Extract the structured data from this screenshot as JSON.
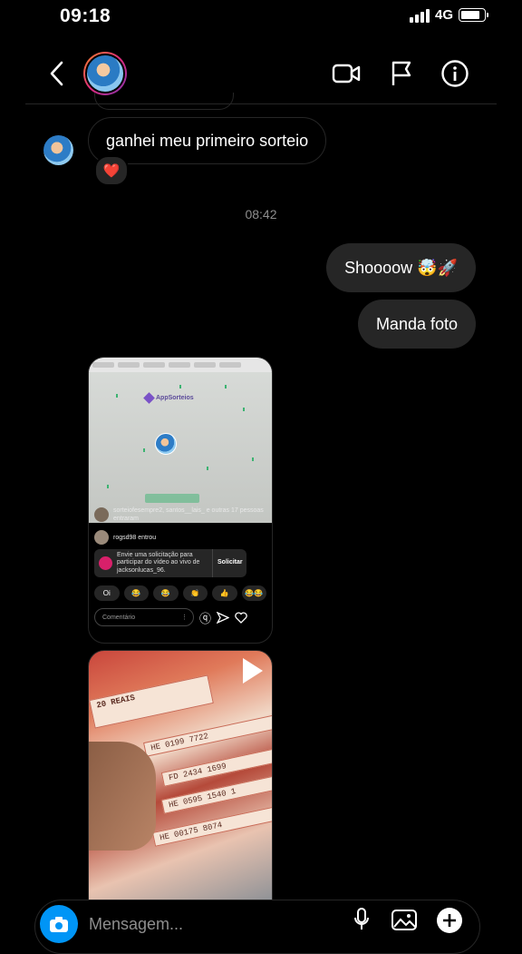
{
  "status_bar": {
    "time": "09:18",
    "network": "4G"
  },
  "thread": {
    "incoming_message": "ganhei meu primeiro sorteio",
    "incoming_reaction": "❤️",
    "timestamp": "08:42",
    "outgoing_messages": [
      "Shoooow 🤯🚀",
      "Manda foto"
    ]
  },
  "shared_screenshot": {
    "app_logo_text": "AppSorteios",
    "live_join_text": "sorteiofesempre2, santos__lais_ e outras 17 pessoas entraram",
    "live_entered_text": "rogsd98 entrou",
    "request_text": "Envie uma solicitação para participar do vídeo ao vivo de jacksonlucas_96.",
    "request_button": "Solicitar",
    "emoji_row": [
      "Oi",
      "😂",
      "😂",
      "👏",
      "👍",
      "😂😂"
    ],
    "comment_placeholder": "Comentário"
  },
  "shared_photo": {
    "note_labels": [
      "20 REAIS",
      "HE 0199 7722",
      "FD 2434 1699",
      "HE 0595 1540 1",
      "HE 00175 8074"
    ]
  },
  "composer": {
    "placeholder": "Mensagem..."
  },
  "colors": {
    "accent": "#0095f6",
    "bubble": "#262626",
    "heart": "#ff3040"
  }
}
